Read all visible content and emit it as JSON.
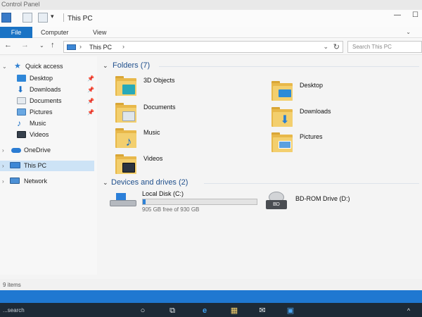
{
  "window": {
    "app_label": "Control Panel",
    "title": "This PC",
    "controls": {
      "minimize": "—",
      "maximize": "☐",
      "help": "?"
    }
  },
  "ribbon": {
    "file": "File",
    "computer": "Computer",
    "view": "View",
    "collapse": "⌄"
  },
  "navigation": {
    "back": "←",
    "forward": "→",
    "recent": "⌄",
    "up": "↑"
  },
  "address": {
    "path": "This PC",
    "separator": "›",
    "dropdown": "⌄",
    "refresh": "↻"
  },
  "search": {
    "placeholder": "Search This PC"
  },
  "sidebar": {
    "quick_access": "Quick access",
    "items": [
      {
        "label": "Desktop",
        "icon": "desktop-icon",
        "pinned": true
      },
      {
        "label": "Downloads",
        "icon": "downloads-icon",
        "pinned": true
      },
      {
        "label": "Documents",
        "icon": "documents-icon",
        "pinned": true
      },
      {
        "label": "Pictures",
        "icon": "pictures-icon",
        "pinned": true
      },
      {
        "label": "Music",
        "icon": "music-icon",
        "pinned": false
      },
      {
        "label": "Videos",
        "icon": "videos-icon",
        "pinned": false
      }
    ],
    "onedrive": "OneDrive",
    "this_pc": "This PC",
    "network": "Network",
    "pin_glyph": "📌"
  },
  "folders": {
    "heading": "Folders (7)",
    "items": [
      {
        "label": "3D Objects",
        "badge_color": "#28a9b8"
      },
      {
        "label": "Desktop",
        "badge_color": "#2b8bd8"
      },
      {
        "label": "Documents",
        "badge_color": "#dfe6ec"
      },
      {
        "label": "Downloads",
        "badge_color": "#2a7fd3"
      },
      {
        "label": "Music",
        "badge_color": "#1b6fc6"
      },
      {
        "label": "Pictures",
        "badge_color": "#5aa0e0"
      },
      {
        "label": "Videos",
        "badge_color": "#2c3440"
      }
    ]
  },
  "drives": {
    "heading": "Devices and drives (2)",
    "local": {
      "name": "Local Disk (C:)",
      "free": "905 GB free of 930 GB",
      "used_fraction": 0.027
    },
    "bd": {
      "name": "BD-ROM Drive (D:)",
      "disc_label": "BD"
    }
  },
  "status": {
    "items": "9 items"
  },
  "taskbar": {
    "search_hint": "...search",
    "icons": [
      "search-icon",
      "task-view-icon",
      "edge-icon",
      "explorer-icon",
      "mail-icon",
      "photos-icon"
    ],
    "glyphs": {
      "search": "○",
      "taskview": "⧉",
      "edge": "e",
      "explorer": "▦",
      "mail": "✉",
      "photos": "▣",
      "tray": "^"
    }
  },
  "colors": {
    "accent": "#1a73c5",
    "selection": "#cde3f6",
    "folder": "#f3cf6e",
    "heading": "#1f4f8c"
  }
}
